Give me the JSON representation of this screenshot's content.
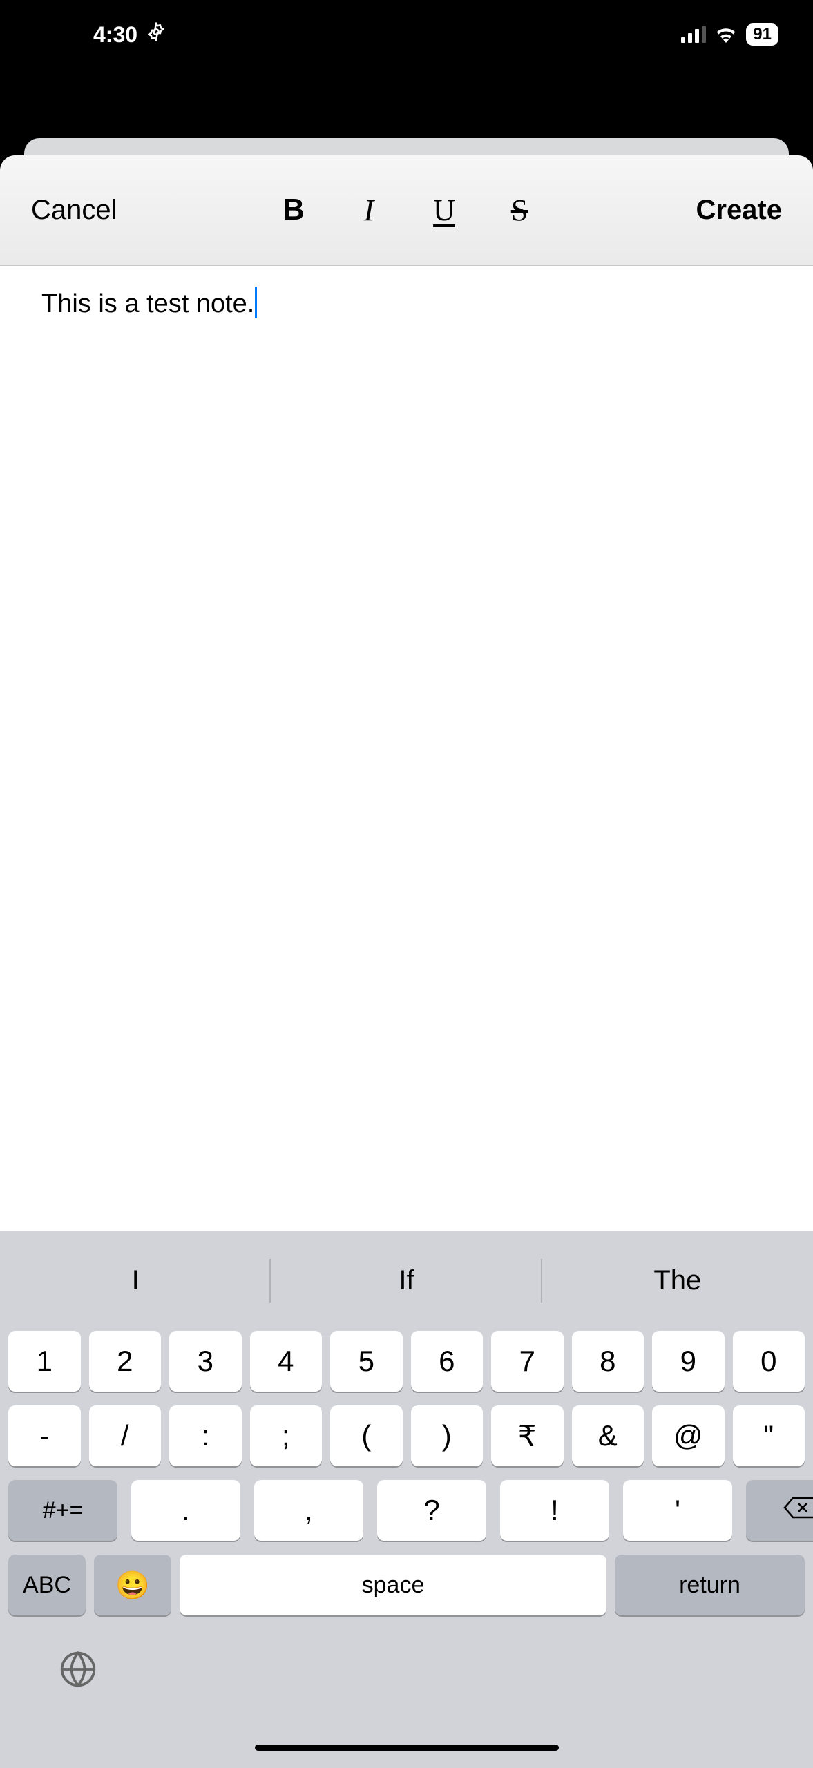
{
  "status_bar": {
    "time": "4:30",
    "battery": "91"
  },
  "toolbar": {
    "cancel": "Cancel",
    "create": "Create",
    "bold": "B",
    "italic": "I",
    "underline": "U",
    "strike": "S"
  },
  "editor": {
    "text": "This is a test note."
  },
  "keyboard": {
    "suggestions": [
      "I",
      "If",
      "The"
    ],
    "row1": [
      "1",
      "2",
      "3",
      "4",
      "5",
      "6",
      "7",
      "8",
      "9",
      "0"
    ],
    "row2": [
      "-",
      "/",
      ":",
      ";",
      "(",
      ")",
      "₹",
      "&",
      "@",
      "\""
    ],
    "row3": {
      "sym_switch": "#+=",
      "keys": [
        ".",
        ",",
        "?",
        "!",
        "'"
      ]
    },
    "row4": {
      "abc": "ABC",
      "space": "space",
      "return": "return"
    }
  }
}
